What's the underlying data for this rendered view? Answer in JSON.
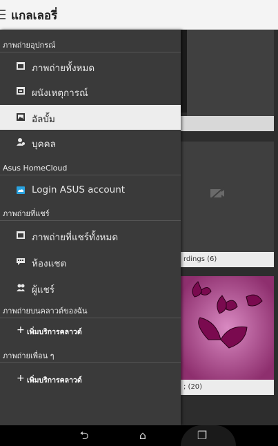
{
  "app": {
    "title": "แกลเลอรี่"
  },
  "drawer": {
    "section_device": "ภาพถ่ายอุปกรณ์",
    "device_items": [
      {
        "label": "ภาพถ่ายทั้งหมด",
        "icon": "photos-icon"
      },
      {
        "label": "ผนังเหตุการณ์",
        "icon": "calendar-icon"
      },
      {
        "label": "อัลบั้ม",
        "icon": "album-icon",
        "selected": true
      },
      {
        "label": "บุคคล",
        "icon": "person-icon"
      }
    ],
    "section_homecloud": "Asus HomeCloud",
    "homecloud_item": {
      "label": "Login ASUS account",
      "icon": "cloud-login-icon",
      "accent": "#2aa3e0"
    },
    "section_shared": "ภาพถ่ายที่แชร์",
    "shared_items": [
      {
        "label": "ภาพถ่ายที่แชร์ทั้งหมด",
        "icon": "photos-icon"
      },
      {
        "label": "ห้องแชต",
        "icon": "chat-icon"
      },
      {
        "label": "ผู้แชร์",
        "icon": "people-icon"
      }
    ],
    "section_mycloud": "ภาพถ่ายบนคลาวด์ของฉัน",
    "add_cloud_1": "เพิ่มบริการคลาวด์",
    "section_friends": "ภาพถ่ายเพื่อน ๆ",
    "add_cloud_2": "เพิ่มบริการคลาวด์",
    "plus_glyph": "+"
  },
  "background": {
    "recordings_caption": "rdings (6)",
    "bottom_caption": "; (20)"
  },
  "navbar": {
    "back_glyph": "⮌",
    "home_glyph": "⌂",
    "recent_glyph": "❐"
  }
}
